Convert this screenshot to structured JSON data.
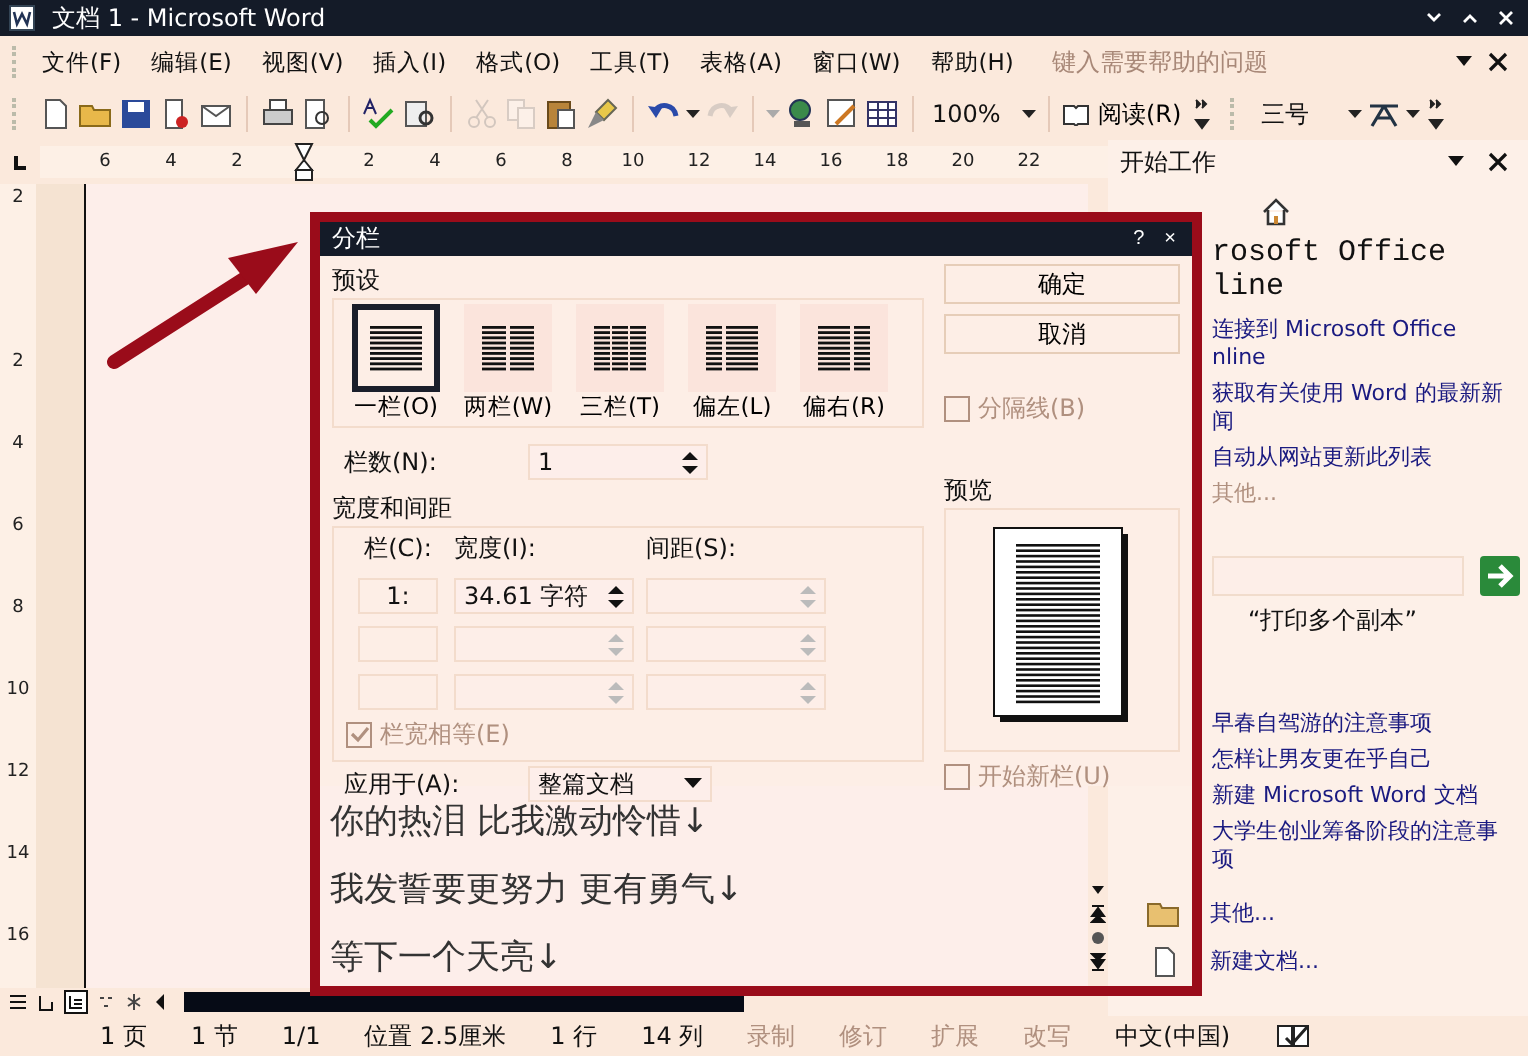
{
  "window": {
    "title": "文档 1 - Microsoft Word"
  },
  "menu": [
    "文件(F)",
    "编辑(E)",
    "视图(V)",
    "插入(I)",
    "格式(O)",
    "工具(T)",
    "表格(A)",
    "窗口(W)",
    "帮助(H)"
  ],
  "help_box": {
    "placeholder": "键入需要帮助的问题"
  },
  "toolbar": {
    "icons": [
      {
        "disabled": false
      },
      {
        "disabled": false
      },
      {
        "disabled": false
      },
      {
        "disabled": false
      },
      {
        "disabled": false
      },
      {
        "disabled": false
      },
      {
        "disabled": false
      },
      {
        "disabled": false
      },
      {
        "disabled": false
      },
      {
        "disabled": true
      },
      {
        "disabled": true
      },
      {
        "disabled": false
      },
      {
        "disabled": false
      },
      {
        "disabled": false
      },
      {
        "disabled": true
      },
      {
        "disabled": false
      },
      {
        "disabled": false
      },
      {
        "disabled": false
      }
    ],
    "zoom": "100%",
    "read_button": "阅读(R)",
    "font_size": "三号"
  },
  "ruler": {
    "horizontal": [
      "6",
      "4",
      "2",
      "2",
      "4",
      "6",
      "8",
      "10",
      "12",
      "14",
      "16",
      "18",
      "20",
      "22"
    ],
    "vertical": [
      "2",
      "2",
      "4",
      "6",
      "8",
      "10",
      "12",
      "14",
      "16"
    ]
  },
  "document": {
    "lines": [
      "你的热泪 比我激动怜惜↓",
      "我发誓要更努力 更有勇气↓",
      "等下一个天亮↓"
    ]
  },
  "dialog": {
    "title": "分栏",
    "help": "?",
    "close": "×",
    "presets_label": "预设",
    "presets": [
      {
        "kind": "one",
        "label": "一栏(O)",
        "selected": true
      },
      {
        "kind": "two",
        "label": "两栏(W)",
        "selected": false
      },
      {
        "kind": "three",
        "label": "三栏(T)",
        "selected": false
      },
      {
        "kind": "left",
        "label": "偏左(L)",
        "selected": false
      },
      {
        "kind": "right",
        "label": "偏右(R)",
        "selected": false
      }
    ],
    "count_label": "栏数(N):",
    "count": "1",
    "width_group": "宽度和间距",
    "headers": [
      "栏(C):",
      "宽度(I):",
      "间距(S):"
    ],
    "rows": [
      {
        "column": "1:",
        "width": "34.61 字符",
        "width_disabled": false,
        "spacing_disabled": true
      },
      {
        "width_disabled": true,
        "spacing_disabled": true
      },
      {
        "width_disabled": true,
        "spacing_disabled": true
      }
    ],
    "equal_width": {
      "label": "栏宽相等(E)",
      "checked": true,
      "disabled": true
    },
    "apply_label": "应用于(A):",
    "apply_value": "整篇文档",
    "buttons": [
      "确定",
      "取消"
    ],
    "separator": {
      "label": "分隔线(B)",
      "checked": false,
      "disabled": true
    },
    "preview_label": "预览",
    "new_column": {
      "label": "开始新栏(U)",
      "checked": false,
      "disabled": true
    }
  },
  "task_pane": {
    "title": "开始工作",
    "heading": [
      "rosoft Office",
      "line"
    ],
    "links": [
      {
        "lines": [
          "连接到 Microsoft Office",
          "nline"
        ],
        "disabled": false
      },
      {
        "lines": [
          "获取有关使用 Word 的最新新",
          "闻"
        ],
        "disabled": false
      },
      {
        "lines": [
          "自动从网站更新此列表"
        ],
        "disabled": false
      },
      {
        "lines": [
          "其他..."
        ],
        "disabled": true
      }
    ],
    "example": "“打印多个副本”",
    "recent": [
      {
        "lines": [
          "早春自驾游的注意事项"
        ]
      },
      {
        "lines": [
          "怎样让男友更在乎自己"
        ]
      },
      {
        "lines": [
          "新建 Microsoft Word 文档"
        ]
      },
      {
        "lines": [
          "大学生创业筹备阶段的注意事",
          "项"
        ]
      }
    ],
    "more": "其他...",
    "new_document": "新建文档..."
  },
  "status_bar": {
    "items": [
      {
        "text": "1 页",
        "disabled": false
      },
      {
        "text": "1 节",
        "disabled": false
      },
      {
        "text": "1/1",
        "disabled": false
      },
      {
        "text": "位置 2.5厘米",
        "disabled": false
      },
      {
        "text": "1 行",
        "disabled": false
      },
      {
        "text": "14 列",
        "disabled": false
      },
      {
        "text": "录制",
        "disabled": true
      },
      {
        "text": "修订",
        "disabled": true
      },
      {
        "text": "扩展",
        "disabled": true
      },
      {
        "text": "改写",
        "disabled": true
      },
      {
        "text": "中文(中国)",
        "disabled": false
      }
    ]
  }
}
